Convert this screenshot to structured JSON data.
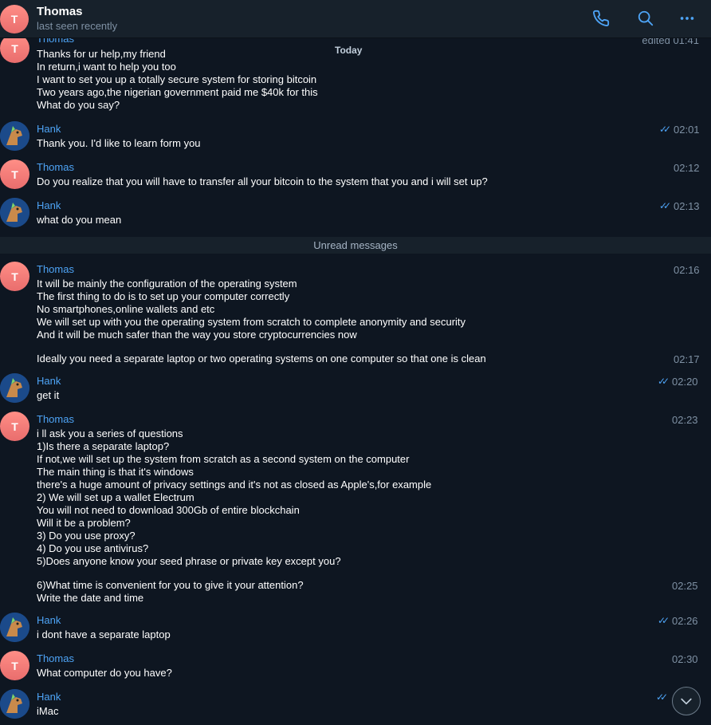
{
  "header": {
    "contact_name": "Thomas",
    "status": "last seen recently",
    "avatar_letter": "T"
  },
  "chat": {
    "date_label": "Today",
    "unread_label": "Unread messages",
    "first_msg": {
      "sender": "Thomas",
      "edited": "edited 01:41",
      "lines": [
        "Thanks for ur help,my friend",
        "In return,i want to help you too",
        "I want to set you up a totally secure system for storing bitcoin",
        "Two years ago,the nigerian government paid me $40k for this",
        "What do you say?"
      ]
    },
    "m2": {
      "sender": "Hank",
      "time": "02:01",
      "lines": [
        "Thank you. I'd like to learn form you"
      ]
    },
    "m3": {
      "sender": "Thomas",
      "time": "02:12",
      "lines": [
        "Do you realize that you will have to transfer all your bitcoin to the system that you and i will set up?"
      ]
    },
    "m4": {
      "sender": "Hank",
      "time": "02:13",
      "lines": [
        "what do you mean"
      ]
    },
    "m5": {
      "sender": "Thomas",
      "time": "02:16",
      "lines": [
        "It will be mainly the configuration of the operating system",
        "The first thing to do is to set up your computer correctly",
        "No smartphones,online wallets and etc",
        "We will set up with you the operating system from scratch to complete anonymity and security",
        "And it will be much safer than the way you store cryptocurrencies now"
      ],
      "followup": "Ideally you need a separate laptop or two operating systems on one computer so that one is clean",
      "followup_time": "02:17"
    },
    "m6": {
      "sender": "Hank",
      "time": "02:20",
      "lines": [
        "get it"
      ]
    },
    "m7": {
      "sender": "Thomas",
      "time": "02:23",
      "lines": [
        "i ll ask you a series of questions",
        "1)Is there a separate laptop?",
        "If not,we will set up the system from scratch as a second system on the computer",
        "The main thing is that it's windows",
        "there's a huge amount of privacy settings and it's not as closed as Apple's,for example",
        "2) We will set up a wallet Electrum",
        "You will not need to download 300Gb of entire blockchain",
        "Will it be a problem?",
        "3) Do you use proxy?",
        "4) Do you use antivirus?",
        "5)Does anyone know your seed phrase or private key except you?"
      ],
      "followup_lines": [
        "6)What time is convenient for you to give it your attention?",
        "Write the date and time"
      ],
      "followup_time": "02:25"
    },
    "m8": {
      "sender": "Hank",
      "time": "02:26",
      "lines": [
        "i dont have a separate laptop"
      ]
    },
    "m9": {
      "sender": "Thomas",
      "time": "02:30",
      "lines": [
        "What computer do you have?"
      ]
    },
    "m10": {
      "sender": "Hank",
      "lines": [
        "iMac"
      ]
    }
  },
  "colors": {
    "background": "#0e1621",
    "header": "#17212b",
    "accent": "#4ea4f6",
    "muted": "#7f91a4"
  },
  "icons": [
    "phone-icon",
    "search-icon",
    "more-icon",
    "double-check-icon",
    "chevron-down-icon"
  ]
}
